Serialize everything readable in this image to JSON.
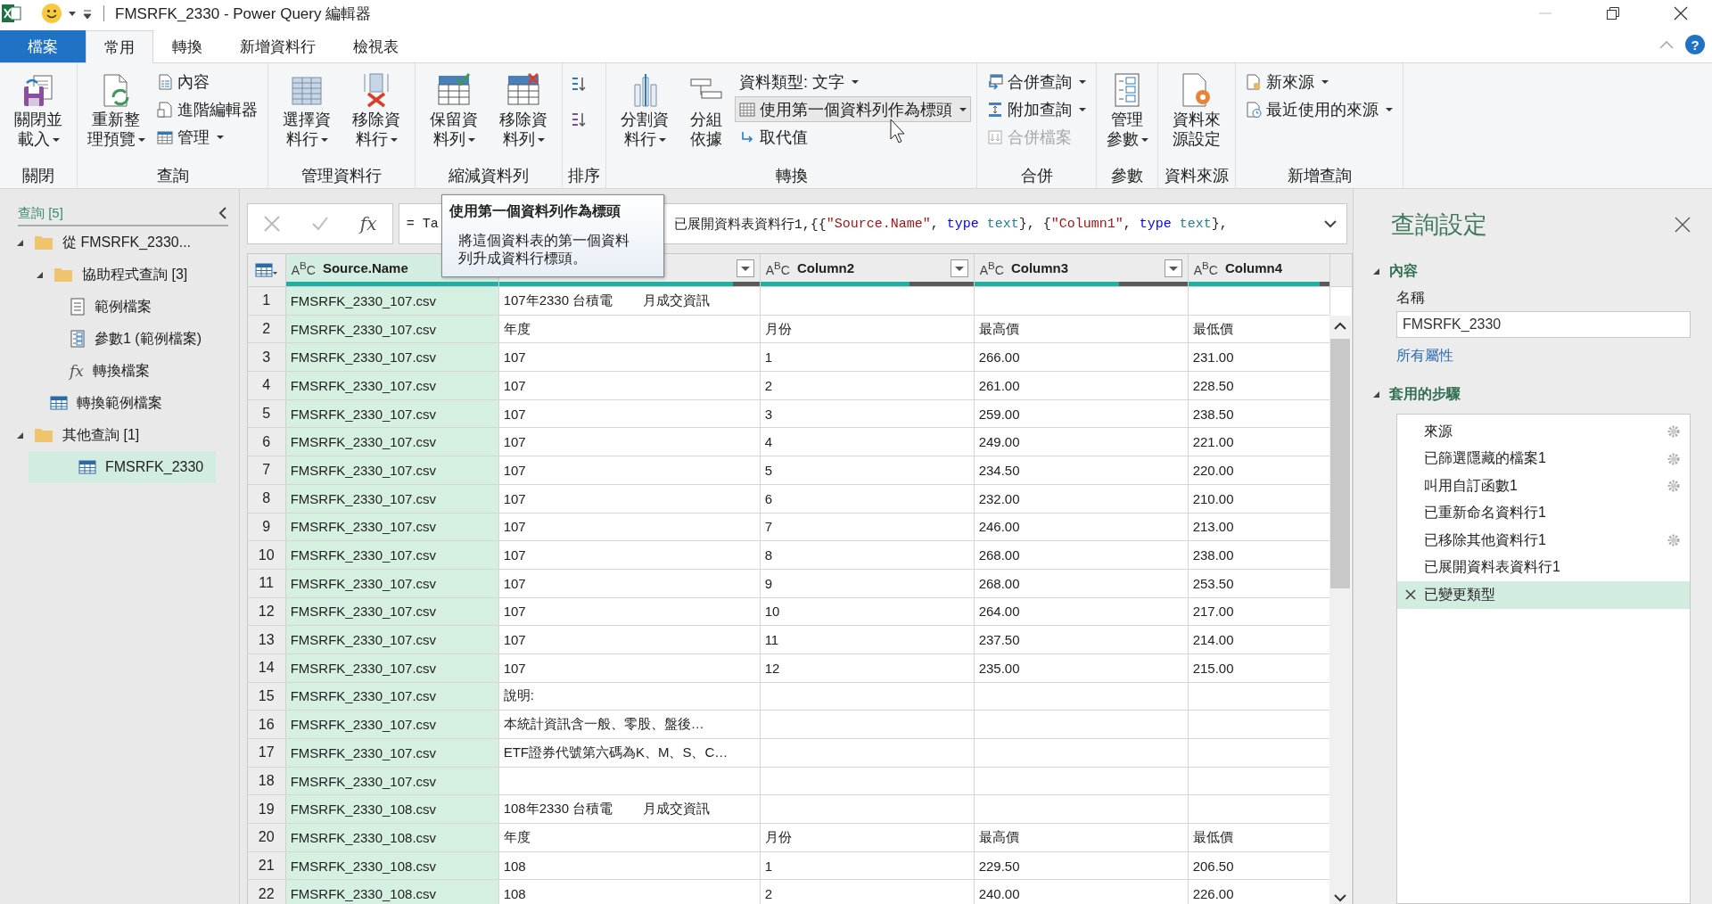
{
  "window": {
    "title": "FMSRFK_2330 - Power Query 編輯器"
  },
  "tabs": [
    {
      "label": "檔案",
      "kind": "file",
      "selected": false
    },
    {
      "label": "常用",
      "kind": "tab",
      "selected": true
    },
    {
      "label": "轉換",
      "kind": "tab",
      "selected": false
    },
    {
      "label": "新增資料行",
      "kind": "tab",
      "selected": false
    },
    {
      "label": "檢視表",
      "kind": "tab",
      "selected": false
    }
  ],
  "help": "?",
  "ribbon": {
    "groups": [
      {
        "label": "關閉",
        "buttons": [
          {
            "kind": "large",
            "label": "關閉並載入",
            "dropdown": true
          }
        ]
      },
      {
        "label": "查詢",
        "buttons": [
          {
            "kind": "large",
            "label": "重新整理預覽",
            "dropdown": true
          },
          {
            "kind": "small",
            "label": "內容",
            "dropdown": false
          },
          {
            "kind": "small",
            "label": "進階編輯器",
            "dropdown": false
          },
          {
            "kind": "small",
            "label": "管理",
            "dropdown": true
          }
        ]
      },
      {
        "label": "管理資料行",
        "buttons": [
          {
            "kind": "large",
            "label": "選擇資料行",
            "dropdown": true
          },
          {
            "kind": "large",
            "label": "移除資料行",
            "dropdown": true
          }
        ]
      },
      {
        "label": "縮減資料列",
        "buttons": [
          {
            "kind": "large",
            "label": "保留資料列",
            "dropdown": true
          },
          {
            "kind": "large",
            "label": "移除資料列",
            "dropdown": true
          }
        ]
      },
      {
        "label": "排序",
        "buttons": [
          {
            "kind": "icon"
          },
          {
            "kind": "icon"
          }
        ]
      },
      {
        "label": "轉換",
        "buttons": [
          {
            "kind": "large",
            "label": "分割資料行",
            "dropdown": true
          },
          {
            "kind": "large",
            "label": "分組依據",
            "dropdown": false
          },
          {
            "kind": "small",
            "label": "資料類型: 文字",
            "dropdown": true
          },
          {
            "kind": "small",
            "label": "使用第一個資料列作為標頭",
            "dropdown": true,
            "hovered": true
          },
          {
            "kind": "small",
            "label": "取代值",
            "dropdown": false
          }
        ]
      },
      {
        "label": "合併",
        "buttons": [
          {
            "kind": "small",
            "label": "合併查詢",
            "dropdown": true
          },
          {
            "kind": "small",
            "label": "附加查詢",
            "dropdown": true
          },
          {
            "kind": "small",
            "label": "合併檔案",
            "dropdown": false,
            "disabled": true
          }
        ]
      },
      {
        "label": "參數",
        "buttons": [
          {
            "kind": "large",
            "label": "管理參數",
            "dropdown": true
          }
        ]
      },
      {
        "label": "資料來源",
        "buttons": [
          {
            "kind": "large",
            "label": "資料來源設定",
            "dropdown": false
          }
        ]
      },
      {
        "label": "新增查詢",
        "buttons": [
          {
            "kind": "small",
            "label": "新來源",
            "dropdown": true
          },
          {
            "kind": "small",
            "label": "最近使用的來源",
            "dropdown": true
          }
        ]
      }
    ]
  },
  "queries": {
    "title": "查詢 [5]",
    "items": [
      {
        "label": "從 FMSRFK_2330...",
        "kind": "folder",
        "expanded": true,
        "selected": false,
        "children": [
          {
            "label": "協助程式查詢 [3]",
            "kind": "folder",
            "expanded": true,
            "selected": false,
            "children": [
              {
                "label": "範例檔案",
                "kind": "document",
                "selected": false
              },
              {
                "label": "參數1 (範例檔案)",
                "kind": "parameter",
                "selected": false
              },
              {
                "label": "轉換檔案",
                "kind": "function",
                "icon_text": "fx",
                "selected": false
              }
            ]
          },
          {
            "label": "轉換範例檔案",
            "kind": "table",
            "selected": false
          }
        ]
      },
      {
        "label": "其他查詢 [1]",
        "kind": "folder",
        "expanded": true,
        "selected": false,
        "children": [
          {
            "label": "FMSRFK_2330",
            "kind": "table",
            "selected": true
          }
        ]
      }
    ]
  },
  "formula_bar": {
    "fx": "fx",
    "start": "= Ta",
    "tokens": [
      {
        "kind": "plain",
        "text": "已展開資料表資料行1,{{"
      },
      {
        "kind": "string",
        "text": "\"Source.Name\""
      },
      {
        "kind": "plain",
        "text": ", "
      },
      {
        "kind": "keyword",
        "text": "type"
      },
      {
        "kind": "type",
        "text": " text"
      },
      {
        "kind": "plain",
        "text": "}, {"
      },
      {
        "kind": "string",
        "text": "\"Column1\""
      },
      {
        "kind": "plain",
        "text": ", "
      },
      {
        "kind": "keyword",
        "text": "type"
      },
      {
        "kind": "type",
        "text": " text"
      },
      {
        "kind": "plain",
        "text": "},"
      }
    ]
  },
  "tooltip": {
    "title": "使用第一個資料列作為標頭",
    "body": "將這個資料表的第一個資料列升成資料行標頭。"
  },
  "table": {
    "columns": [
      {
        "name": "Source.Name",
        "type_label": "A$^{B}$C",
        "filter": false,
        "selected": true,
        "level": 1
      },
      {
        "filter": true,
        "selected": false,
        "level": 0.9
      },
      {
        "name": "Column2",
        "type_label": "A$^{B}$C",
        "filter": true,
        "selected": false,
        "level": 0.7
      },
      {
        "name": "Column3",
        "type_label": "A$^{B}$C",
        "filter": true,
        "selected": false,
        "level": 0.68
      },
      {
        "name": "Column4",
        "type_label": "A$^{B}$C",
        "filter": false,
        "selected": false,
        "level": 0.93
      }
    ],
    "rows": [
      {
        "n": "1",
        "cells": [
          "FMSRFK_2330_107.csv",
          "107年2330 台積電        月成交資訊",
          null,
          null,
          null
        ]
      },
      {
        "n": "2",
        "cells": [
          "FMSRFK_2330_107.csv",
          "年度",
          "月份",
          "最高價",
          "最低價"
        ]
      },
      {
        "n": "3",
        "cells": [
          "FMSRFK_2330_107.csv",
          "107",
          "1",
          "266.00",
          "231.00"
        ]
      },
      {
        "n": "4",
        "cells": [
          "FMSRFK_2330_107.csv",
          "107",
          "2",
          "261.00",
          "228.50"
        ]
      },
      {
        "n": "5",
        "cells": [
          "FMSRFK_2330_107.csv",
          "107",
          "3",
          "259.00",
          "238.50"
        ]
      },
      {
        "n": "6",
        "cells": [
          "FMSRFK_2330_107.csv",
          "107",
          "4",
          "249.00",
          "221.00"
        ]
      },
      {
        "n": "7",
        "cells": [
          "FMSRFK_2330_107.csv",
          "107",
          "5",
          "234.50",
          "220.00"
        ]
      },
      {
        "n": "8",
        "cells": [
          "FMSRFK_2330_107.csv",
          "107",
          "6",
          "232.00",
          "210.00"
        ]
      },
      {
        "n": "9",
        "cells": [
          "FMSRFK_2330_107.csv",
          "107",
          "7",
          "246.00",
          "213.00"
        ]
      },
      {
        "n": "10",
        "cells": [
          "FMSRFK_2330_107.csv",
          "107",
          "8",
          "268.00",
          "238.00"
        ]
      },
      {
        "n": "11",
        "cells": [
          "FMSRFK_2330_107.csv",
          "107",
          "9",
          "268.00",
          "253.50"
        ]
      },
      {
        "n": "12",
        "cells": [
          "FMSRFK_2330_107.csv",
          "107",
          "10",
          "264.00",
          "217.00"
        ]
      },
      {
        "n": "13",
        "cells": [
          "FMSRFK_2330_107.csv",
          "107",
          "11",
          "237.50",
          "214.00"
        ]
      },
      {
        "n": "14",
        "cells": [
          "FMSRFK_2330_107.csv",
          "107",
          "12",
          "235.00",
          "215.00"
        ]
      },
      {
        "n": "15",
        "cells": [
          "FMSRFK_2330_107.csv",
          "說明:",
          null,
          null,
          null
        ]
      },
      {
        "n": "16",
        "cells": [
          "FMSRFK_2330_107.csv",
          "本統計資訊含一般、零股、盤後…",
          null,
          null,
          null
        ]
      },
      {
        "n": "17",
        "cells": [
          "FMSRFK_2330_107.csv",
          "ETF證券代號第六碼為K、M、S、C…",
          null,
          null,
          null
        ]
      },
      {
        "n": "18",
        "cells": [
          "FMSRFK_2330_107.csv",
          null,
          null,
          null,
          null
        ]
      },
      {
        "n": "19",
        "cells": [
          "FMSRFK_2330_108.csv",
          "108年2330 台積電        月成交資訊",
          null,
          null,
          null
        ]
      },
      {
        "n": "20",
        "cells": [
          "FMSRFK_2330_108.csv",
          "年度",
          "月份",
          "最高價",
          "最低價"
        ]
      },
      {
        "n": "21",
        "cells": [
          "FMSRFK_2330_108.csv",
          "108",
          "1",
          "229.50",
          "206.50"
        ]
      },
      {
        "n": "22",
        "cells": [
          "FMSRFK_2330_108.csv",
          "108",
          "2",
          "240.00",
          "226.00"
        ]
      }
    ]
  },
  "settings": {
    "title": "查詢設定",
    "properties": {
      "header": "內容",
      "name_label": "名稱",
      "name_value": "FMSRFK_2330",
      "link": "所有屬性"
    },
    "steps_header": "套用的步驟",
    "steps": [
      {
        "label": "來源",
        "settings": true,
        "selected": false
      },
      {
        "label": "已篩選隱藏的檔案1",
        "settings": true,
        "selected": false
      },
      {
        "label": "叫用自訂函數1",
        "settings": true,
        "selected": false
      },
      {
        "label": "已重新命名資料行1",
        "settings": false,
        "selected": false
      },
      {
        "label": "已移除其他資料行1",
        "settings": true,
        "selected": false
      },
      {
        "label": "已展開資料表資料行1",
        "settings": false,
        "selected": false
      },
      {
        "label": "已變更類型",
        "settings": false,
        "selected": true
      }
    ]
  }
}
